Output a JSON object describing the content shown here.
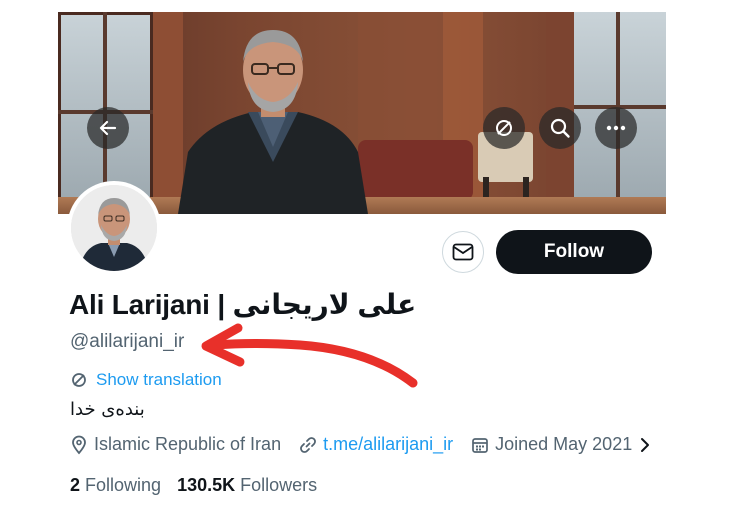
{
  "profile": {
    "display_name": "Ali Larijani | علی لاریجانی",
    "handle": "@alilarijani_ir",
    "bio": "بنده‌ی خدا",
    "location": "Islamic Republic of Iran",
    "website": "t.me/alilarijani_ir",
    "joined": "Joined May 2021",
    "following_count": "2",
    "following_label": "Following",
    "followers_count": "130.5K",
    "followers_label": "Followers"
  },
  "actions": {
    "follow_label": "Follow",
    "show_translation_label": "Show translation"
  },
  "icons": {
    "back": "arrow-left-icon",
    "translate": "translate-icon",
    "search": "search-icon",
    "more": "more-horizontal-icon",
    "message": "envelope-icon",
    "location": "location-pin-icon",
    "link": "link-icon",
    "calendar": "calendar-icon",
    "chevron": "chevron-right-icon"
  },
  "colors": {
    "accent": "#1d9bf0",
    "text_primary": "#0f1419",
    "text_secondary": "#536471",
    "follow_button": "#0f1419",
    "annotation_arrow": "#e8302a"
  }
}
